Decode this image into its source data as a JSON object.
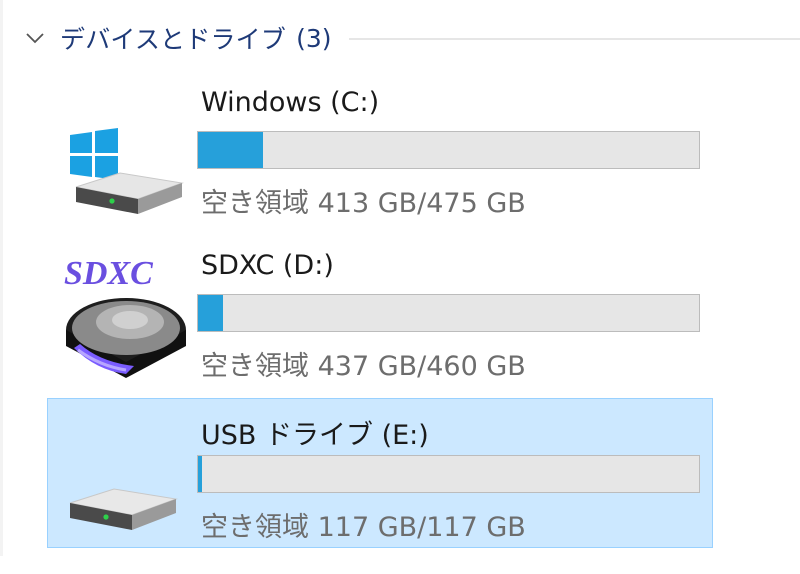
{
  "group": {
    "title": "デバイスとドライブ",
    "count": "(3)",
    "expanded": true,
    "chevron_icon": "chevron-down-icon"
  },
  "drives": [
    {
      "name": "Windows (C:)",
      "free_text": "空き領域 413 GB/475 GB",
      "used_fraction": 0.13,
      "icon": "windows-drive-icon",
      "selected": false
    },
    {
      "name": "SDXC (D:)",
      "free_text": "空き領域 437 GB/460 GB",
      "used_fraction": 0.05,
      "icon": "sdxc-drive-icon",
      "icon_label": "SDXC",
      "selected": false
    },
    {
      "name": "USB ドライブ (E:)",
      "free_text": "空き領域 117 GB/117 GB",
      "used_fraction": 0.008,
      "icon": "usb-drive-icon",
      "selected": true
    }
  ],
  "colors": {
    "header_text": "#1e3a78",
    "bar_fill": "#26a0da",
    "bar_track": "#e6e6e6",
    "selected_bg": "#cce8ff",
    "selected_border": "#99d1ff",
    "sdxc_label": "#6a4fe0"
  }
}
